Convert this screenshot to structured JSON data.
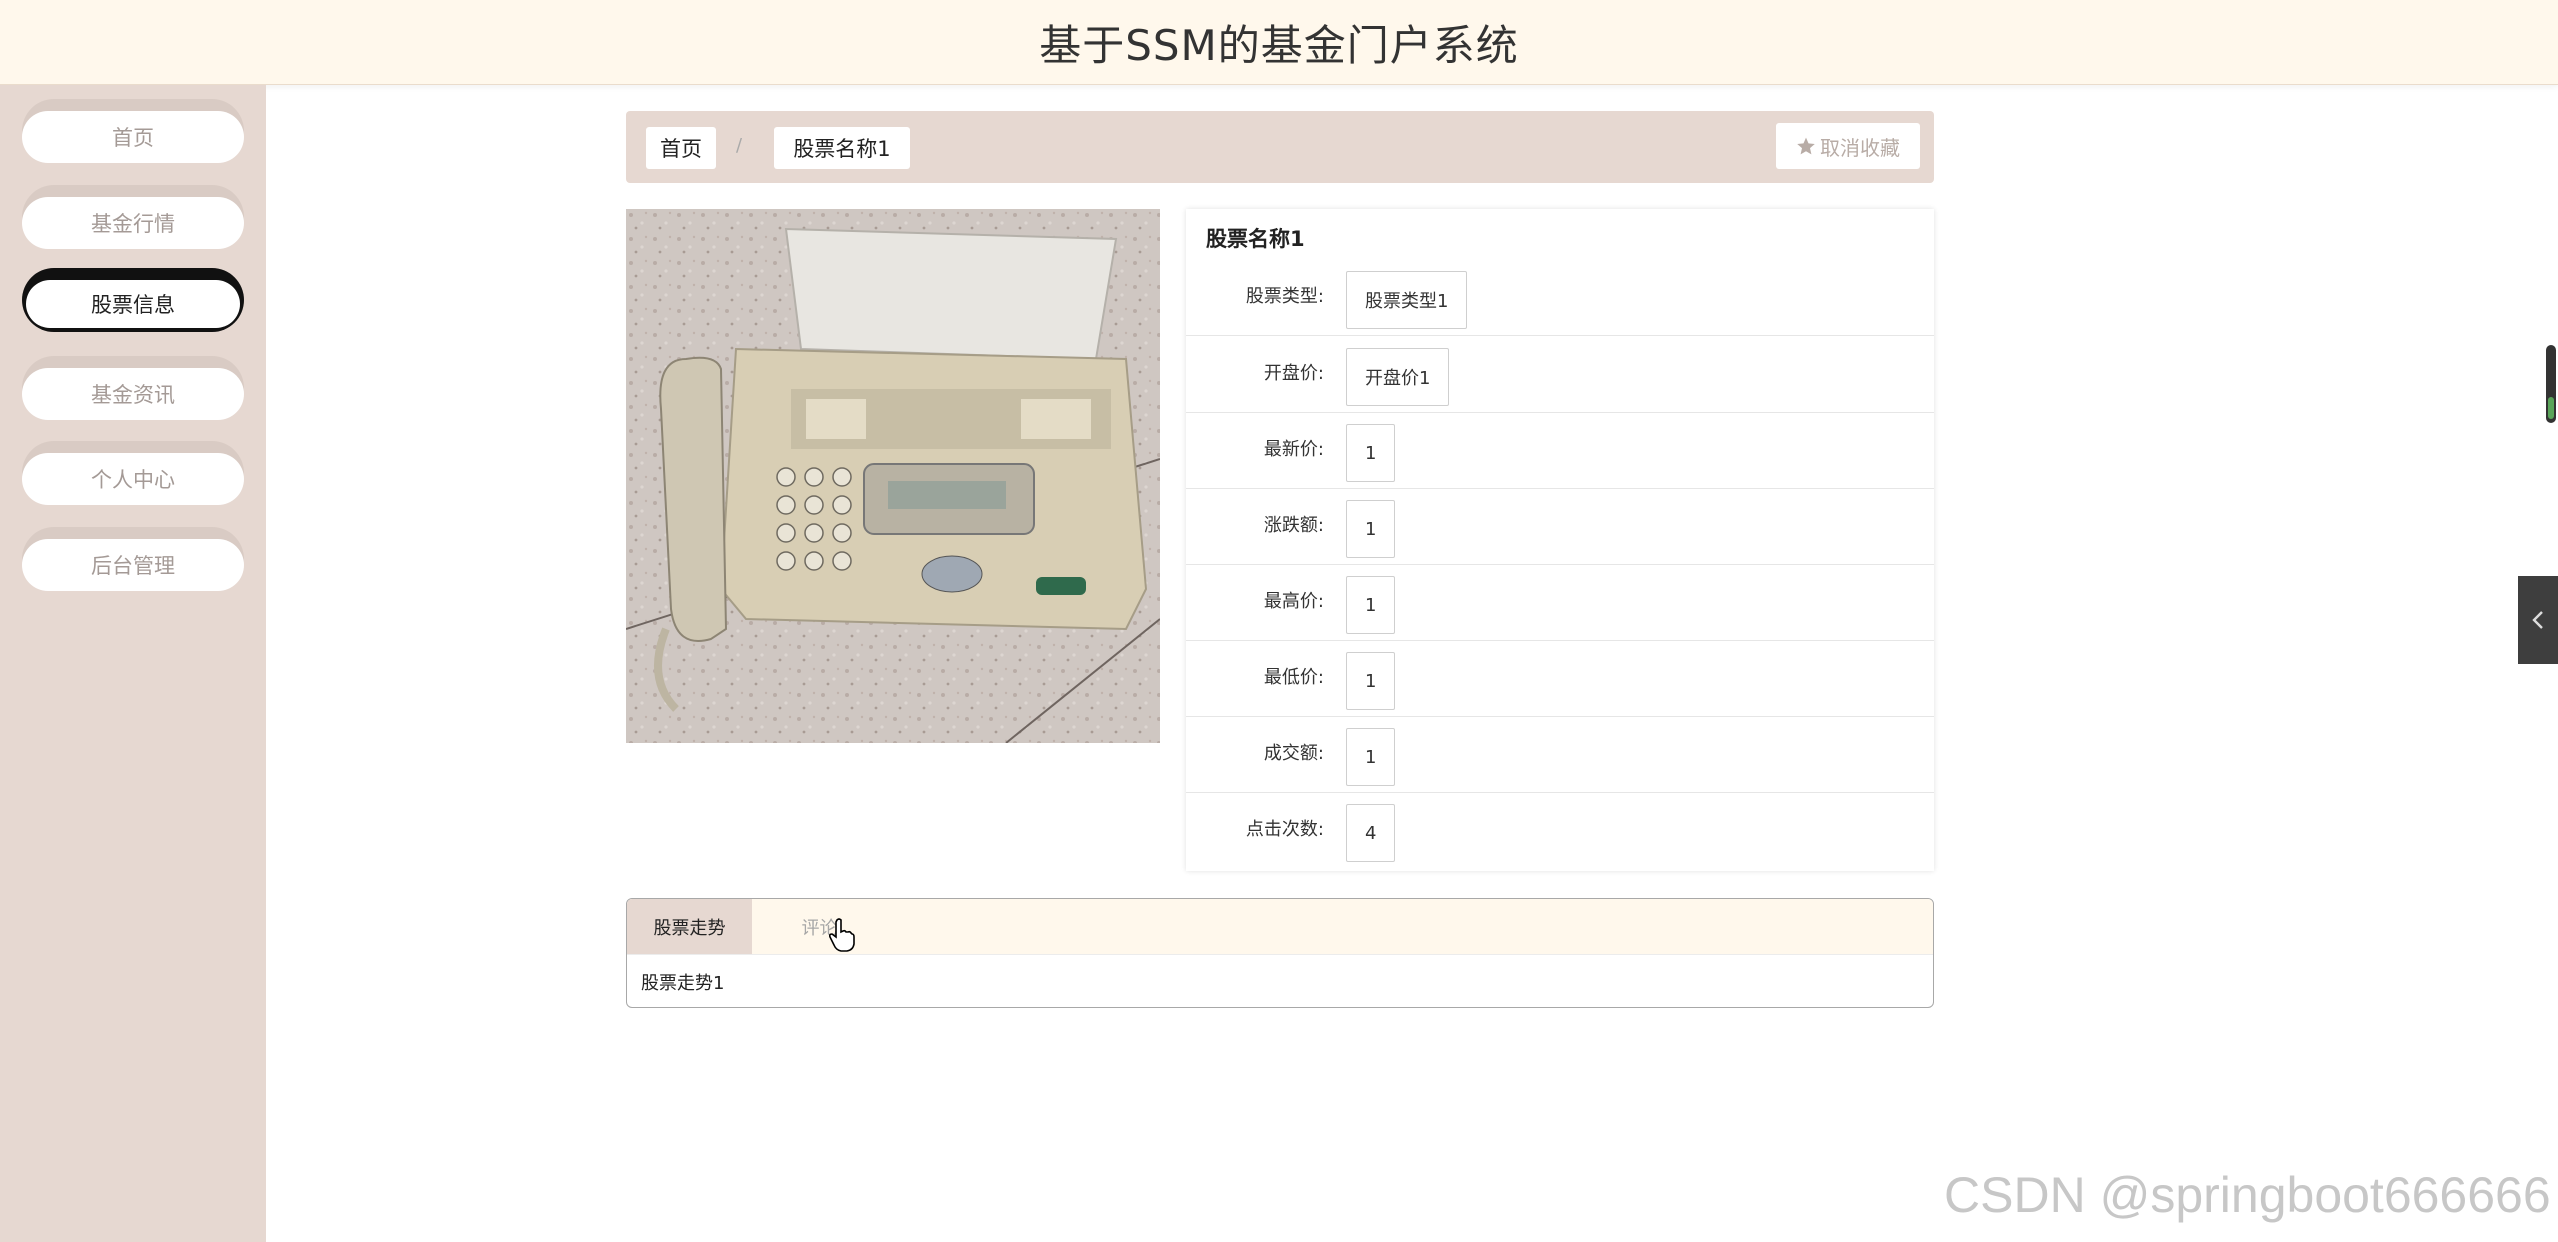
{
  "header": {
    "title": "基于SSM的基金门户系统"
  },
  "sidebar": {
    "items": [
      {
        "label": "首页",
        "active": false
      },
      {
        "label": "基金行情",
        "active": false
      },
      {
        "label": "股票信息",
        "active": true
      },
      {
        "label": "基金资讯",
        "active": false
      },
      {
        "label": "个人中心",
        "active": false
      },
      {
        "label": "后台管理",
        "active": false
      }
    ]
  },
  "breadcrumb": {
    "home": "首页",
    "separator": "/",
    "current": "股票名称1"
  },
  "favorite": {
    "label": "取消收藏",
    "icon": "star-icon"
  },
  "product": {
    "name": "股票名称1",
    "fields": [
      {
        "label": "股票类型:",
        "value": "股票类型1"
      },
      {
        "label": "开盘价:",
        "value": "开盘价1"
      },
      {
        "label": "最新价:",
        "value": "1"
      },
      {
        "label": "涨跌额:",
        "value": "1"
      },
      {
        "label": "最高价:",
        "value": "1"
      },
      {
        "label": "最低价:",
        "value": "1"
      },
      {
        "label": "成交额:",
        "value": "1"
      },
      {
        "label": "点击次数:",
        "value": "4"
      }
    ]
  },
  "tabs": {
    "items": [
      {
        "label": "股票走势",
        "active": true
      },
      {
        "label": "评论",
        "active": false
      }
    ],
    "content": "股票走势1"
  },
  "watermark": "CSDN @springboot666666",
  "colors": {
    "header_bg": "#fff8ec",
    "sidebar_bg": "#e6d8d1",
    "accent_dark": "#111111",
    "muted_text": "#a49a96"
  }
}
